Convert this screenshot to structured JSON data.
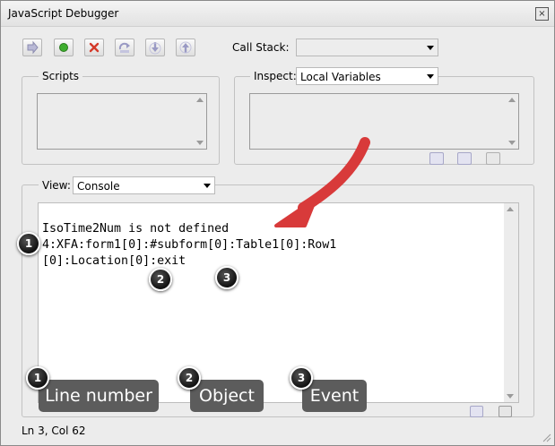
{
  "window": {
    "title": "JavaScript Debugger",
    "close_label": "×"
  },
  "toolbar": {
    "buttons": [
      {
        "name": "continue-icon"
      },
      {
        "name": "record-icon"
      },
      {
        "name": "clear-icon"
      },
      {
        "name": "step-over-icon"
      },
      {
        "name": "step-into-icon"
      },
      {
        "name": "step-out-icon"
      }
    ],
    "call_stack_label": "Call Stack:",
    "call_stack_value": ""
  },
  "scripts": {
    "title": "Scripts"
  },
  "inspect": {
    "label": "Inspect:",
    "value": "Local Variables"
  },
  "view": {
    "label": "View:",
    "value": "Console"
  },
  "console": {
    "lines": [
      "IsoTime2Num is not defined",
      "4:XFA:form1[0]:#subform[0]:Table1[0]:Row1",
      "[0]:Location[0]:exit"
    ]
  },
  "annotations": {
    "badges": [
      "1",
      "2",
      "3"
    ],
    "legend": [
      {
        "number": "1",
        "label": "Line number"
      },
      {
        "number": "2",
        "label": "Object"
      },
      {
        "number": "3",
        "label": "Event"
      }
    ],
    "arrow_color": "#d83a3a"
  },
  "status": {
    "text": "Ln 3, Col 62"
  },
  "colors": {
    "window_bg": "#ececec",
    "console_bg": "#ffffff",
    "badge_bg": "#222222",
    "pill_bg": "#5c5c5c"
  }
}
